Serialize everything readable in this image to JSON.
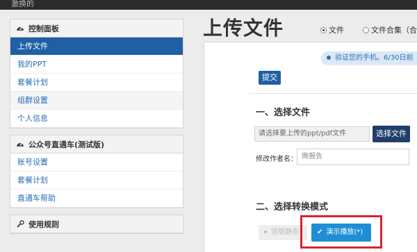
{
  "topbar": {
    "text": "激换的"
  },
  "sidebar": {
    "panels": [
      {
        "title": "控制面板",
        "icon": "dashboard-icon",
        "items": [
          {
            "label": "上传文件",
            "active": true
          },
          {
            "label": "我的PPT"
          },
          {
            "label": "套餐计划"
          },
          {
            "label": "组群设置"
          },
          {
            "label": "个人信息"
          }
        ]
      },
      {
        "title": "公众号直通车(测试版)",
        "icon": "dashboard-icon",
        "items": [
          {
            "label": "账号设置"
          },
          {
            "label": "套餐计划"
          },
          {
            "label": "直通车帮助"
          }
        ]
      },
      {
        "title": "使用规则",
        "icon": "wrench-icon",
        "items": []
      }
    ]
  },
  "main": {
    "title": "上传文件",
    "radio_file": "文件",
    "radio_collection": "文件合集（合",
    "notice": "验证您的手机。6/30日前",
    "submit_label": "提交",
    "section1_title": "一、选择文件",
    "file_placeholder": "请选择要上传的ppt/pdf文件",
    "choose_file_label": "选择文件",
    "author_label": "修改作者名：",
    "author_value": "微报告",
    "section2_title": "二、选择转换模式",
    "mode_static_label": "竖版静态",
    "mode_demo_label": "演示播放(*)",
    "highlight_color": "#d9232a",
    "accent_color": "#1f5fa4"
  }
}
